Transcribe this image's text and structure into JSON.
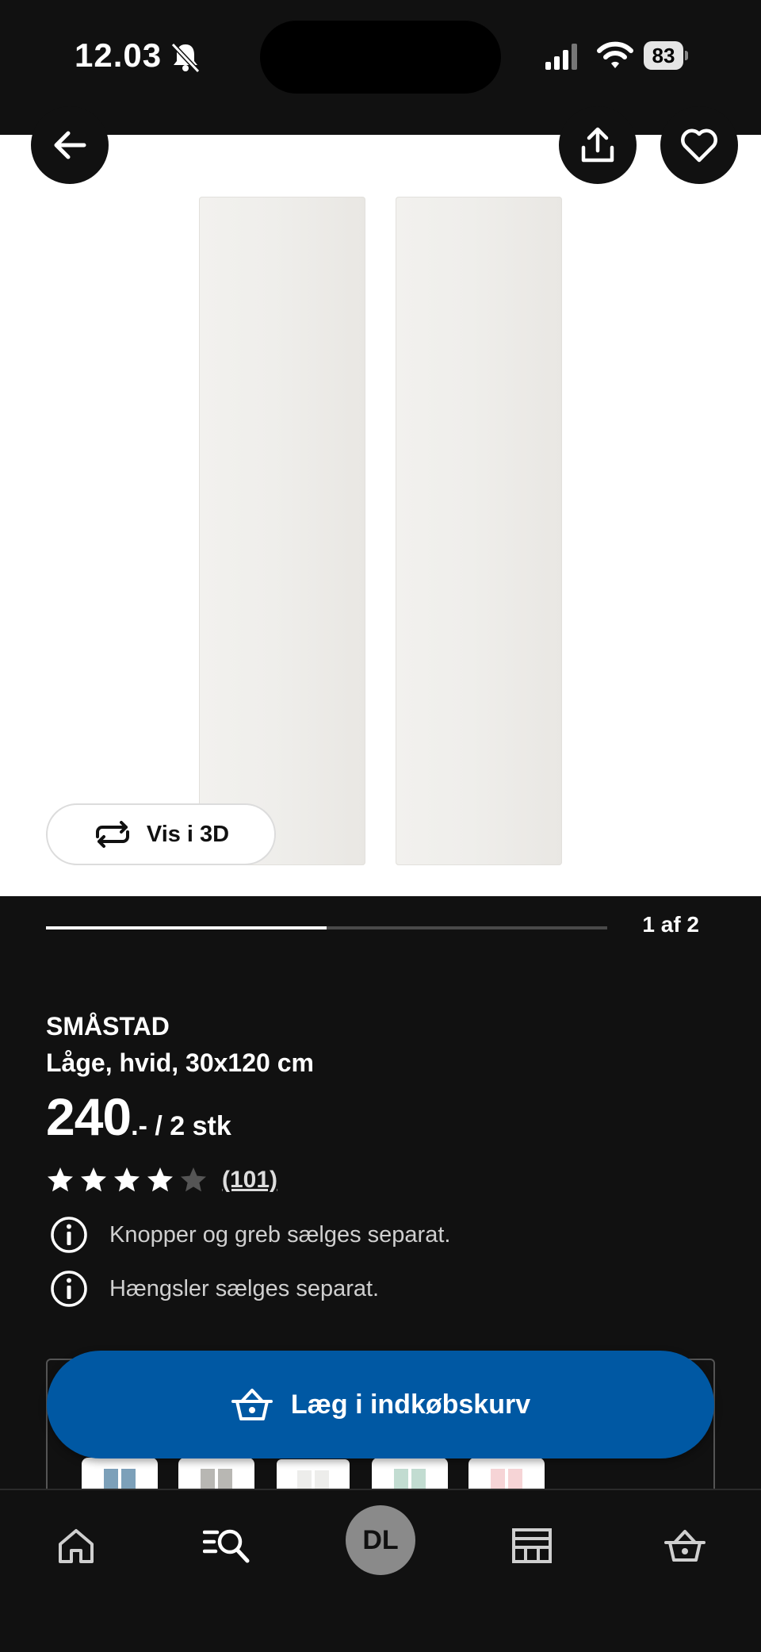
{
  "status_bar": {
    "time": "12.03",
    "battery": "83"
  },
  "product": {
    "name": "SMÅSTAD",
    "description": "Låge, hvid, 30x120 cm",
    "price_integer": "240",
    "price_suffix": ".- / 2 stk",
    "rating": 4,
    "rating_max": 5,
    "review_count": "(101)"
  },
  "gallery": {
    "view_3d_label": "Vis i 3D",
    "page_indicator": "1 af 2",
    "progress": 0.5
  },
  "notices": [
    "Knopper og greb sælges separat.",
    "Hængsler sælges separat."
  ],
  "cart": {
    "add_label": "Læg i indkøbskurv"
  },
  "swatches": [
    "#7ca0b9",
    "#b8b7b3",
    "#ededeb",
    "#c2dcd1",
    "#f6d4d6"
  ],
  "nav": {
    "items": [
      "home-icon",
      "search-icon",
      "profile",
      "store-icon",
      "cart-icon"
    ],
    "avatar_initials": "DL"
  },
  "colors": {
    "accent": "#0058a3",
    "background": "#111111"
  }
}
